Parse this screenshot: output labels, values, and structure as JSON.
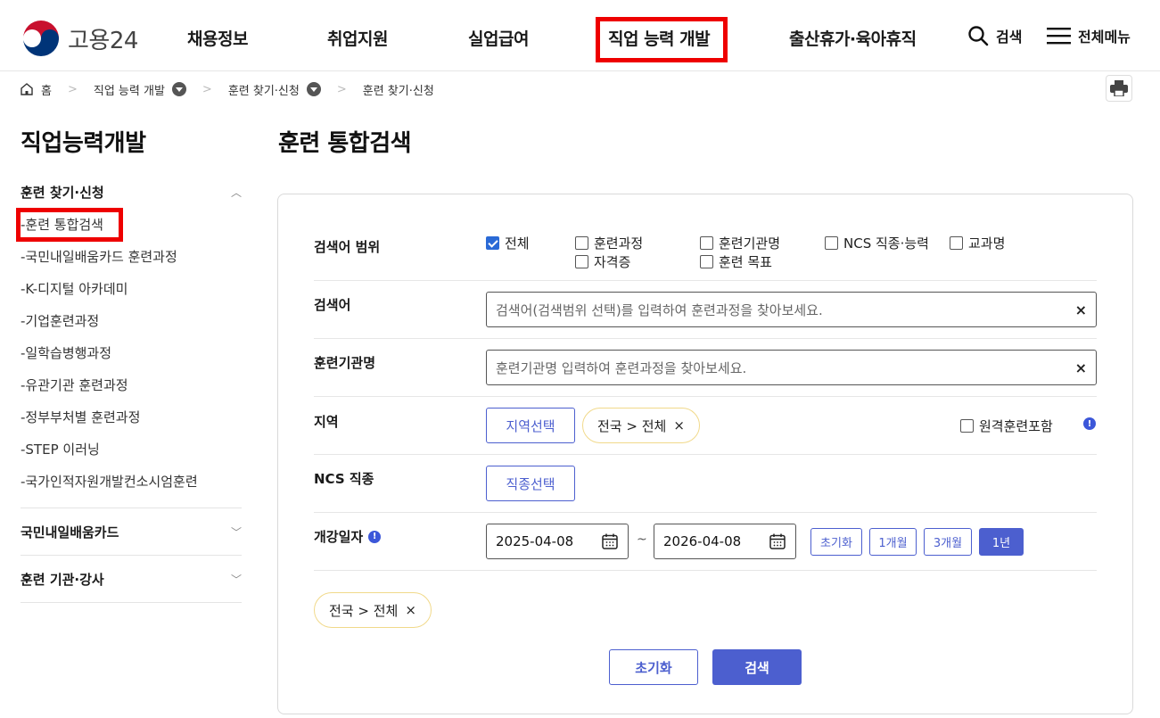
{
  "header": {
    "logo_text": "고용24",
    "nav": [
      "채용정보",
      "취업지원",
      "실업급여",
      "직업 능력 개발",
      "출산휴가·육아휴직"
    ],
    "search_label": "검색",
    "menu_label": "전체메뉴"
  },
  "breadcrumb": {
    "home": "홈",
    "items": [
      "직업 능력 개발",
      "훈련 찾기·신청",
      "훈련 찾기·신청"
    ]
  },
  "sidebar": {
    "title": "직업능력개발",
    "section1": "훈련 찾기·신청",
    "items": [
      "-훈련 통합검색",
      "-국민내일배움카드 훈련과정",
      "-K-디지털 아카데미",
      "-기업훈련과정",
      "-일학습병행과정",
      "-유관기관 훈련과정",
      "-정부부처별 훈련과정",
      "-STEP 이러닝",
      "-국가인적자원개발컨소시엄훈련"
    ],
    "section2": "국민내일배움카드",
    "section3": "훈련 기관·강사"
  },
  "main": {
    "title": "훈련 통합검색",
    "scope_label": "검색어 범위",
    "scope_options": [
      {
        "label": "전체",
        "checked": true
      },
      {
        "label": "훈련과정",
        "checked": false
      },
      {
        "label": "훈련기관명",
        "checked": false
      },
      {
        "label": "NCS 직종·능력",
        "checked": false
      },
      {
        "label": "교과명",
        "checked": false
      },
      {
        "label": "자격증",
        "checked": false
      },
      {
        "label": "훈련 목표",
        "checked": false
      }
    ],
    "keyword_label": "검색어",
    "keyword_placeholder": "검색어(검색범위 선택)를 입력하여 훈련과정을 찾아보세요.",
    "institution_label": "훈련기관명",
    "institution_placeholder": "훈련기관명 입력하여 훈련과정을 찾아보세요.",
    "region_label": "지역",
    "region_button": "지역선택",
    "region_chip": "전국 > 전체",
    "remote_label": "원격훈련포함",
    "ncs_label": "NCS 직종",
    "ncs_button": "직종선택",
    "date_label": "개강일자",
    "date_from": "2025-04-08",
    "date_to": "2026-04-08",
    "date_sep": "~",
    "period_buttons": [
      "초기화",
      "1개월",
      "3개월",
      "1년"
    ],
    "period_active": "1년",
    "summary_chip": "전국 > 전체",
    "reset_button": "초기화",
    "search_button": "검색",
    "info_mark": "!",
    "clear_mark": "×"
  },
  "colors": {
    "accent": "#4c5fcf",
    "highlight": "#ee0000",
    "chip_border": "#f1d98a"
  }
}
